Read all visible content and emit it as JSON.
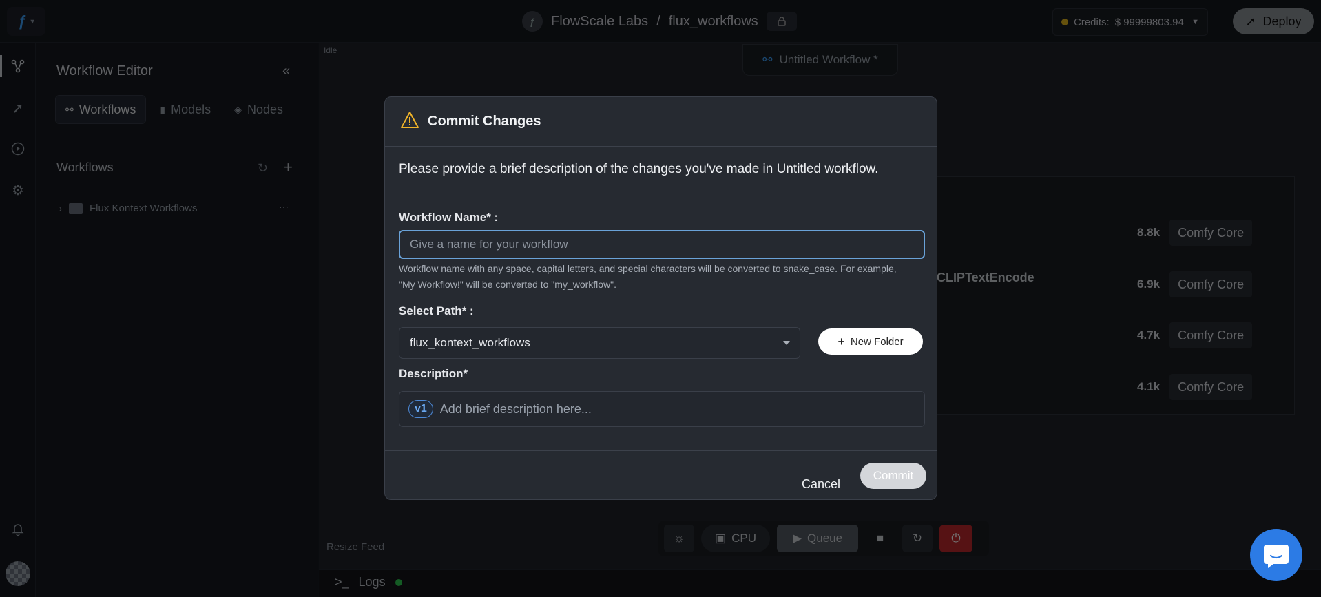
{
  "topbar": {
    "workspace": "FlowScale Labs",
    "separator": "/",
    "project": "flux_workflows",
    "credits_label": "Credits:",
    "credits_value": "$ 99999803.94",
    "deploy_label": "Deploy"
  },
  "panel": {
    "title": "Workflow Editor",
    "tabs": [
      {
        "label": "Workflows",
        "active": true
      },
      {
        "label": "Models",
        "active": false
      },
      {
        "label": "Nodes",
        "active": false
      }
    ],
    "section_title": "Workflows",
    "folder_name": "Flux Kontext Workflows",
    "more": "···"
  },
  "canvas": {
    "status": "Idle",
    "tab_title": "Untitled Workflow *",
    "clip_node": "CLIPTextEncode",
    "node_rows": [
      {
        "count": "8.8k",
        "source": "Comfy Core"
      },
      {
        "count": "6.9k",
        "source": "Comfy Core"
      },
      {
        "count": "4.7k",
        "source": "Comfy Core"
      },
      {
        "count": "4.1k",
        "source": "Comfy Core"
      }
    ],
    "cpu_label": "CPU",
    "queue_label": "Queue",
    "resize_label": "Resize Feed",
    "logs_label": "Logs"
  },
  "modal": {
    "title": "Commit Changes",
    "description": "Please provide a brief description of the changes you've made in Untitled workflow.",
    "name_label": "Workflow Name* :",
    "name_placeholder": "Give a name for your workflow",
    "name_help": "Workflow name with any space, capital letters, and special characters will be converted to snake_case. For example, \"My Workflow!\" will be converted to \"my_workflow\".",
    "path_label": "Select Path* :",
    "path_value": "flux_kontext_workflows",
    "new_folder_label": "New Folder",
    "description_label": "Description*",
    "version_badge": "v1",
    "description_placeholder": "Add brief description here...",
    "cancel_label": "Cancel",
    "commit_label": "Commit"
  },
  "colors": {
    "accent": "#2c7be5",
    "warning": "#f0b429",
    "status_online": "#2ecc50",
    "danger": "#c0292e"
  }
}
